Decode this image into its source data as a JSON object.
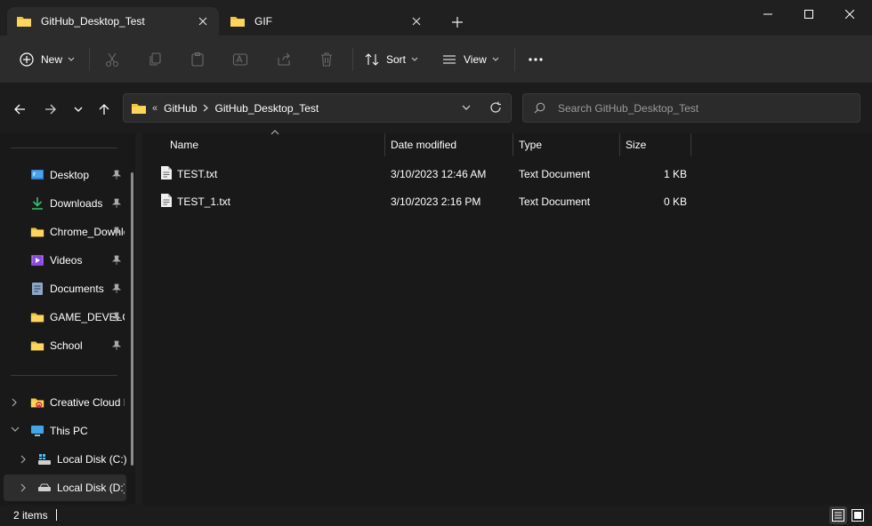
{
  "tabs": [
    {
      "label": "GitHub_Desktop_Test",
      "active": true
    },
    {
      "label": "GIF",
      "active": false
    }
  ],
  "toolbar": {
    "new_label": "New",
    "sort_label": "Sort",
    "view_label": "View"
  },
  "address": {
    "overflow": "«",
    "crumbs": [
      "GitHub",
      "GitHub_Desktop_Test"
    ]
  },
  "search": {
    "placeholder": "Search GitHub_Desktop_Test"
  },
  "sidebar": {
    "quick_access": [
      {
        "label": "Desktop",
        "icon": "desktop-icon",
        "pinned": true
      },
      {
        "label": "Downloads",
        "icon": "download-icon",
        "pinned": true
      },
      {
        "label": "Chrome_Downloads",
        "icon": "folder-icon",
        "pinned": true
      },
      {
        "label": "Videos",
        "icon": "videos-icon",
        "pinned": true
      },
      {
        "label": "Documents",
        "icon": "documents-icon",
        "pinned": true
      },
      {
        "label": "GAME_DEVELOPMENT",
        "icon": "folder-icon",
        "pinned": true
      },
      {
        "label": "School",
        "icon": "folder-icon",
        "pinned": true
      }
    ],
    "tree": [
      {
        "label": "Creative Cloud Files",
        "icon": "creative-cloud-icon",
        "expanded": false
      },
      {
        "label": "This PC",
        "icon": "this-pc-icon",
        "expanded": true
      },
      {
        "label": "Local Disk (C:)",
        "icon": "drive-c-icon",
        "expanded": false
      },
      {
        "label": "Local Disk (D:)",
        "icon": "drive-d-icon",
        "expanded": false,
        "selected": true
      }
    ]
  },
  "columns": {
    "name": "Name",
    "date": "Date modified",
    "type": "Type",
    "size": "Size"
  },
  "files": [
    {
      "name": "TEST.txt",
      "date": "3/10/2023 12:46 AM",
      "type": "Text Document",
      "size": "1 KB"
    },
    {
      "name": "TEST_1.txt",
      "date": "3/10/2023 2:16 PM",
      "type": "Text Document",
      "size": "0 KB"
    }
  ],
  "status": {
    "items_text": "2 items"
  },
  "colors": {
    "folder": "#f3c33f",
    "accent": "#4cc2ff",
    "background": "#191919",
    "chrome": "#2c2c2c"
  }
}
